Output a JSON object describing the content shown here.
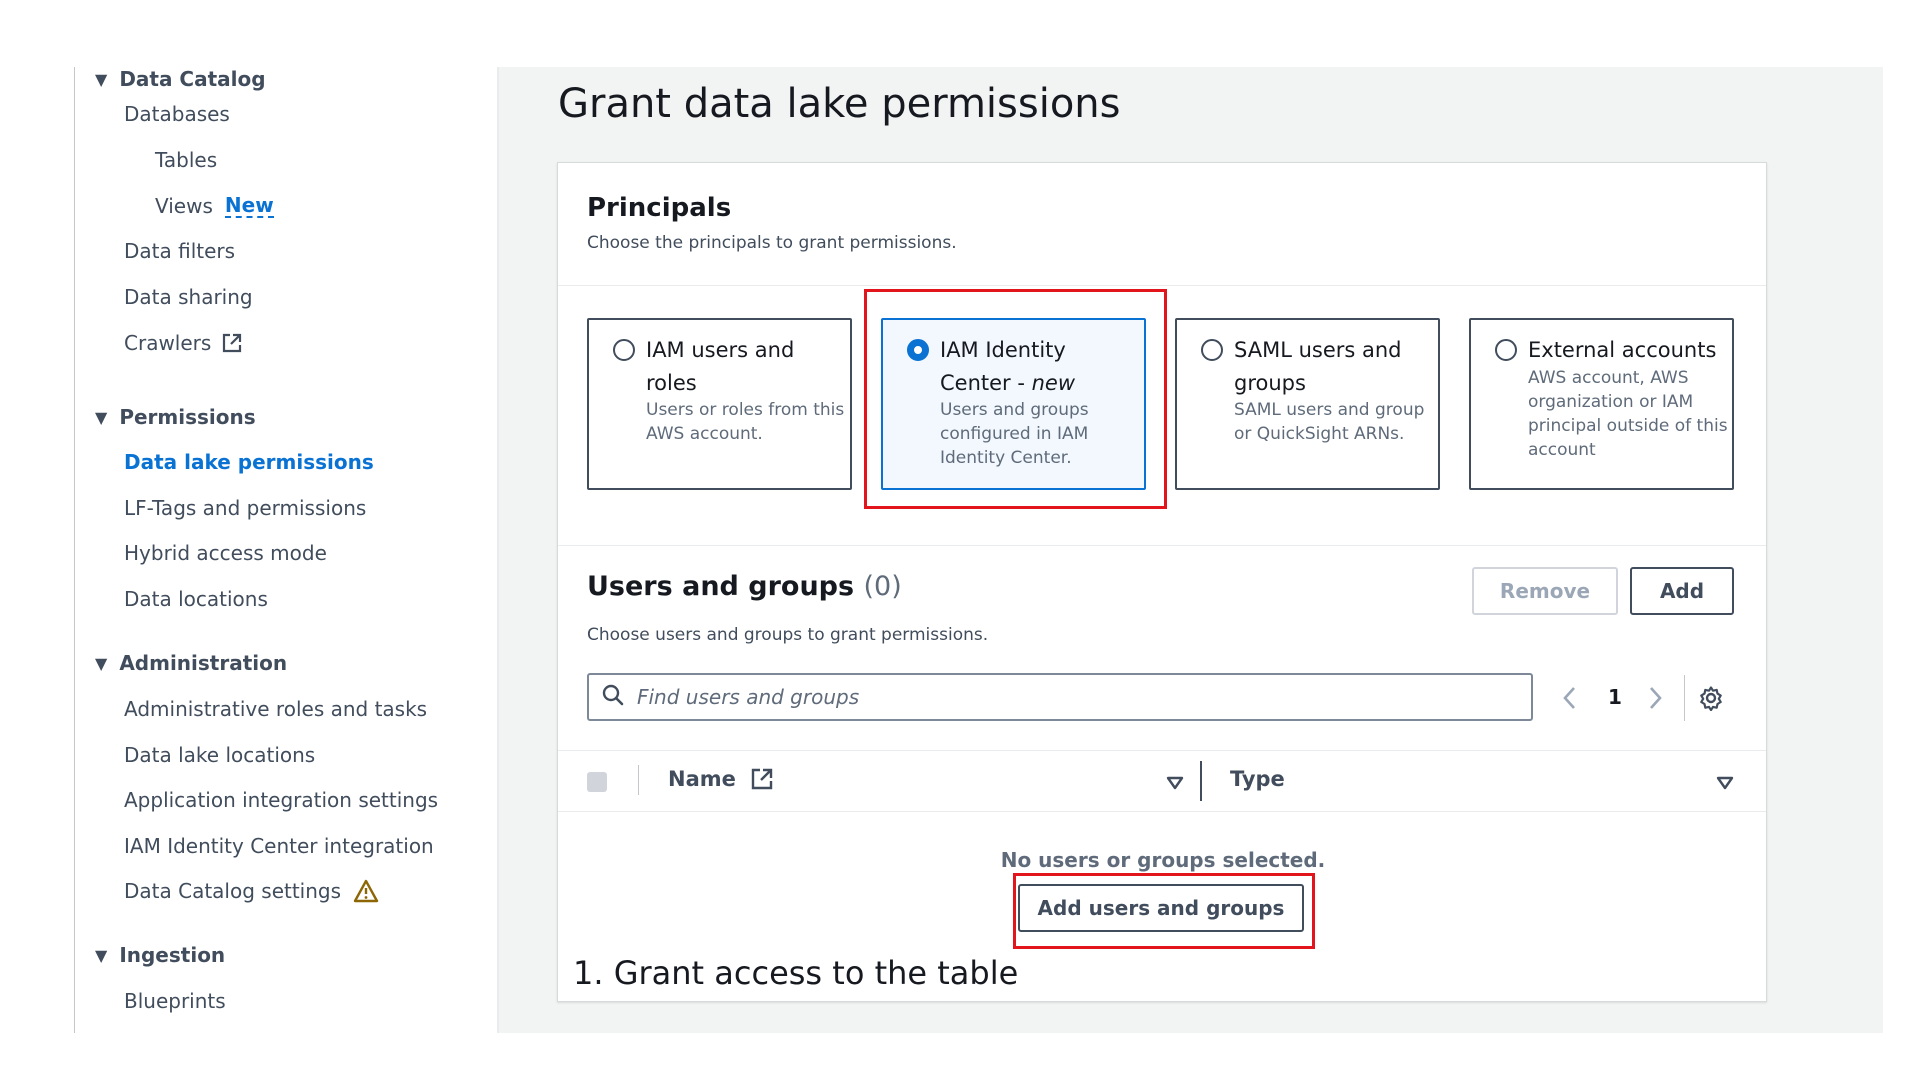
{
  "sidebar": {
    "sections": [
      {
        "label": "Data Catalog"
      },
      {
        "label": "Permissions"
      },
      {
        "label": "Administration"
      },
      {
        "label": "Ingestion"
      }
    ],
    "items": [
      {
        "label": "Databases"
      },
      {
        "label": "Tables"
      },
      {
        "label": "Views",
        "badge": "New"
      },
      {
        "label": "Data filters"
      },
      {
        "label": "Data sharing"
      },
      {
        "label": "Crawlers"
      },
      {
        "label": "Data lake permissions",
        "active": true
      },
      {
        "label": "LF-Tags and permissions"
      },
      {
        "label": "Hybrid access mode"
      },
      {
        "label": "Data locations"
      },
      {
        "label": "Administrative roles and tasks"
      },
      {
        "label": "Data lake locations"
      },
      {
        "label": "Application integration settings"
      },
      {
        "label": "IAM Identity Center integration"
      },
      {
        "label": "Data Catalog settings"
      },
      {
        "label": "Blueprints"
      }
    ]
  },
  "page": {
    "title": "Grant data lake permissions"
  },
  "principals": {
    "title": "Principals",
    "description": "Choose the principals to grant permissions.",
    "options": [
      {
        "title": "IAM users and roles",
        "description": "Users or roles from this AWS account.",
        "selected": false
      },
      {
        "title": "IAM Identity Center - ",
        "title_suffix": "new",
        "description": "Users and groups configured in IAM Identity Center.",
        "selected": true
      },
      {
        "title": "SAML users and groups",
        "description": "SAML users and group or QuickSight ARNs.",
        "selected": false
      },
      {
        "title": "External accounts",
        "description": "AWS account, AWS organization or IAM principal outside of this account",
        "selected": false
      }
    ]
  },
  "users_groups": {
    "title": "Users and groups",
    "count": "(0)",
    "description": "Choose users and groups to grant permissions.",
    "remove_label": "Remove",
    "add_label": "Add",
    "search_placeholder": "Find users and groups",
    "page_number": "1",
    "columns": [
      "Name",
      "Type"
    ],
    "empty_text": "No users or groups selected.",
    "add_users_label": "Add users and groups"
  },
  "annotation": {
    "caption": "1. Grant access to the table"
  },
  "colors": {
    "accent": "#0972d3",
    "highlight": "#e3151c",
    "text": "#16191f",
    "muted": "#5f6b7a"
  }
}
